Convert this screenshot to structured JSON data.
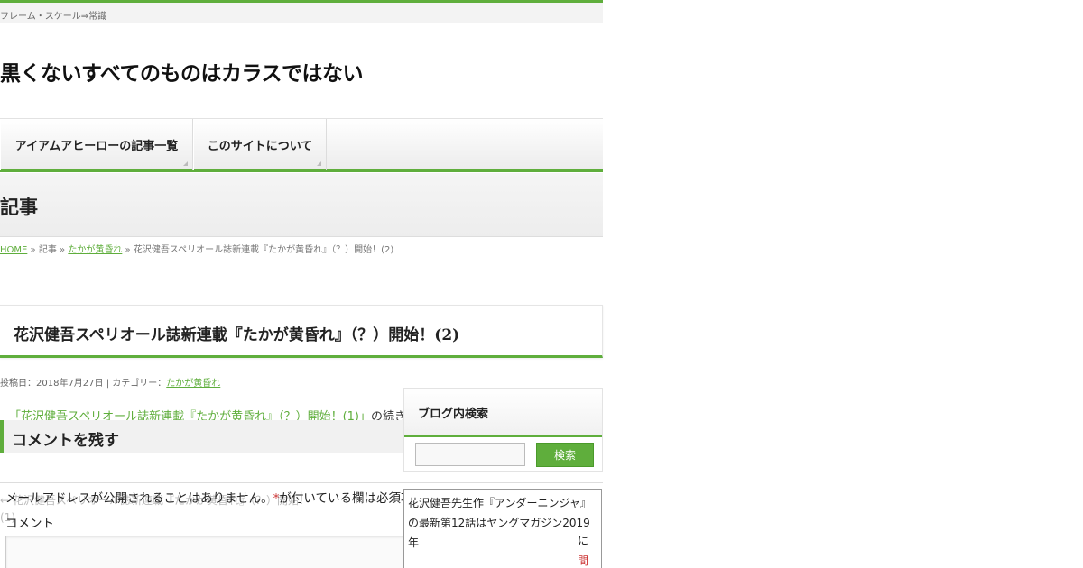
{
  "topbar": {
    "tagline": "フレーム・スケール⇒常識"
  },
  "site": {
    "title": "黒くないすべてのものはカラスではない"
  },
  "nav": {
    "items": [
      {
        "label": "アイアムアヒーローの記事一覧"
      },
      {
        "label": "このサイトについて"
      }
    ]
  },
  "category": {
    "heading": "記事"
  },
  "breadcrumb": {
    "home": "HOME",
    "sep1": "»",
    "section": "記事",
    "sep2": "»",
    "category": "たかが黄昏れ",
    "sep3": "»",
    "current": "花沢健吾スペリオール誌新連載『たかが黄昏れ』（？）開始！(2)"
  },
  "post": {
    "title": "花沢健吾スペリオール誌新連載『たかが黄昏れ』（？）開始！(2)",
    "meta_prefix": "投稿日：2018年7月27日 | カテゴリー：",
    "meta_category": "たかが黄昏れ",
    "intro_link": "「花沢健吾スペリオール誌新連載『たかが黄昏れ』（？）開始！(1)」",
    "intro_rest": "の続きです。完全ネタバレの記事"
  },
  "comments": {
    "heading": "コメントを残す",
    "note_before": "メールアドレスが公開されることはありません。",
    "note_star": "*",
    "note_after": "が付いている欄は必須項目です",
    "comment_label": "コメント"
  },
  "post_nav": {
    "prev": "← 花沢健吾スペリオール誌新連載『たかが黄昏れ』（？）開始！(1)",
    "next": "→"
  },
  "sidebar": {
    "search": {
      "title": "ブログ内検索",
      "button": "検索"
    },
    "box": {
      "text": "花沢健吾先生作『アンダーニンジャ』の最新第12話はヤングマガジン2019年",
      "r1": "に",
      "r2": "間"
    }
  },
  "colors": {
    "accent": "#5fae3c"
  }
}
